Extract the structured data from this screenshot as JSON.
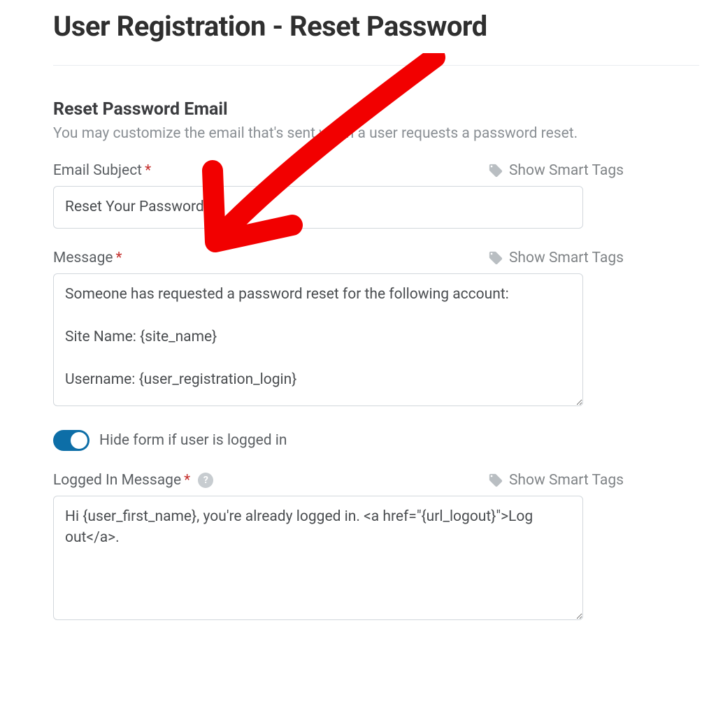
{
  "page_title": "User Registration - Reset Password",
  "section": {
    "title": "Reset Password Email",
    "description": "You may customize the email that's sent when a user requests a password reset."
  },
  "smart_tags_label": "Show Smart Tags",
  "fields": {
    "subject": {
      "label": "Email Subject",
      "required_mark": "*",
      "value": "Reset Your Password"
    },
    "message": {
      "label": "Message",
      "required_mark": "*",
      "value": "Someone has requested a password reset for the following account:\n\nSite Name: {site_name}\n\nUsername: {user_registration_login}"
    },
    "hide_toggle": {
      "label": "Hide form if user is logged in",
      "on": true
    },
    "logged_in": {
      "label": "Logged In Message",
      "required_mark": "*",
      "help": "?",
      "value": "Hi {user_first_name}, you're already logged in. <a href=\"{url_logout}\">Log out</a>."
    }
  }
}
